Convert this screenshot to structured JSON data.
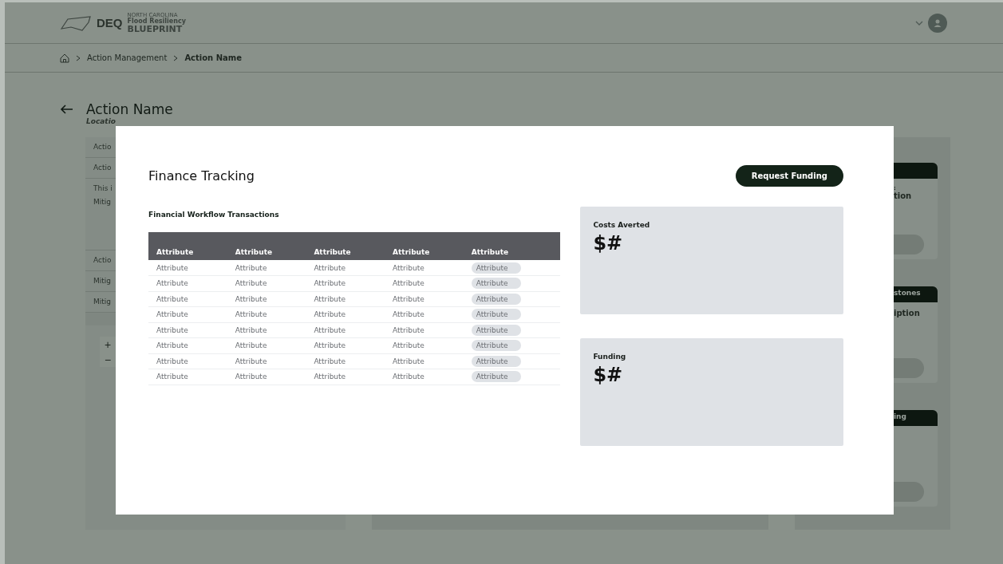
{
  "header": {
    "logo_mark": "DEQ",
    "logo_lines": [
      "NORTH CAROLINA",
      "Flood Resiliency",
      "BLUEPRINT"
    ]
  },
  "breadcrumb": [
    {
      "label": "Action Management",
      "current": false
    },
    {
      "label": "Action Name",
      "current": true
    }
  ],
  "page": {
    "title": "Action Name",
    "subtitle": "Locatio"
  },
  "left_panel": {
    "rows": [
      {
        "lines": [
          "Actio"
        ]
      },
      {
        "lines": [
          "Actio"
        ]
      },
      {
        "lines": [
          "This i",
          "Mitig"
        ]
      },
      {
        "lines": [
          "Actio"
        ]
      },
      {
        "lines": [
          "Mitig"
        ]
      },
      {
        "lines": [
          "Mitig"
        ]
      }
    ],
    "zoom_controls": [
      "+",
      "−"
    ]
  },
  "right_cards": [
    {
      "lines": [
        ":",
        "tion"
      ]
    },
    {
      "header": "stones",
      "lines": [
        "iption"
      ]
    },
    {
      "header": "ing"
    }
  ],
  "modal": {
    "title": "Finance Tracking",
    "button": "Request Funding",
    "table_title": "Financial Workflow Transactions",
    "columns": [
      {
        "label": "Attribute",
        "kind": "text"
      },
      {
        "label": "Attribute",
        "kind": "text"
      },
      {
        "label": "Attribute",
        "kind": "text"
      },
      {
        "label": "Attribute",
        "kind": "text"
      },
      {
        "label": "Attribute",
        "kind": "pill"
      }
    ],
    "rows": [
      [
        "Attribute",
        "Attribute",
        "Attribute",
        "Attribute",
        "Attribute"
      ],
      [
        "Attribute",
        "Attribute",
        "Attribute",
        "Attribute",
        "Attribute"
      ],
      [
        "Attribute",
        "Attribute",
        "Attribute",
        "Attribute",
        "Attribute"
      ],
      [
        "Attribute",
        "Attribute",
        "Attribute",
        "Attribute",
        "Attribute"
      ],
      [
        "Attribute",
        "Attribute",
        "Attribute",
        "Attribute",
        "Attribute"
      ],
      [
        "Attribute",
        "Attribute",
        "Attribute",
        "Attribute",
        "Attribute"
      ],
      [
        "Attribute",
        "Attribute",
        "Attribute",
        "Attribute",
        "Attribute"
      ],
      [
        "Attribute",
        "Attribute",
        "Attribute",
        "Attribute",
        "Attribute"
      ]
    ],
    "cards": [
      {
        "label": "Costs Averted",
        "value": "$#"
      },
      {
        "label": "Funding",
        "value": "$#"
      }
    ]
  }
}
